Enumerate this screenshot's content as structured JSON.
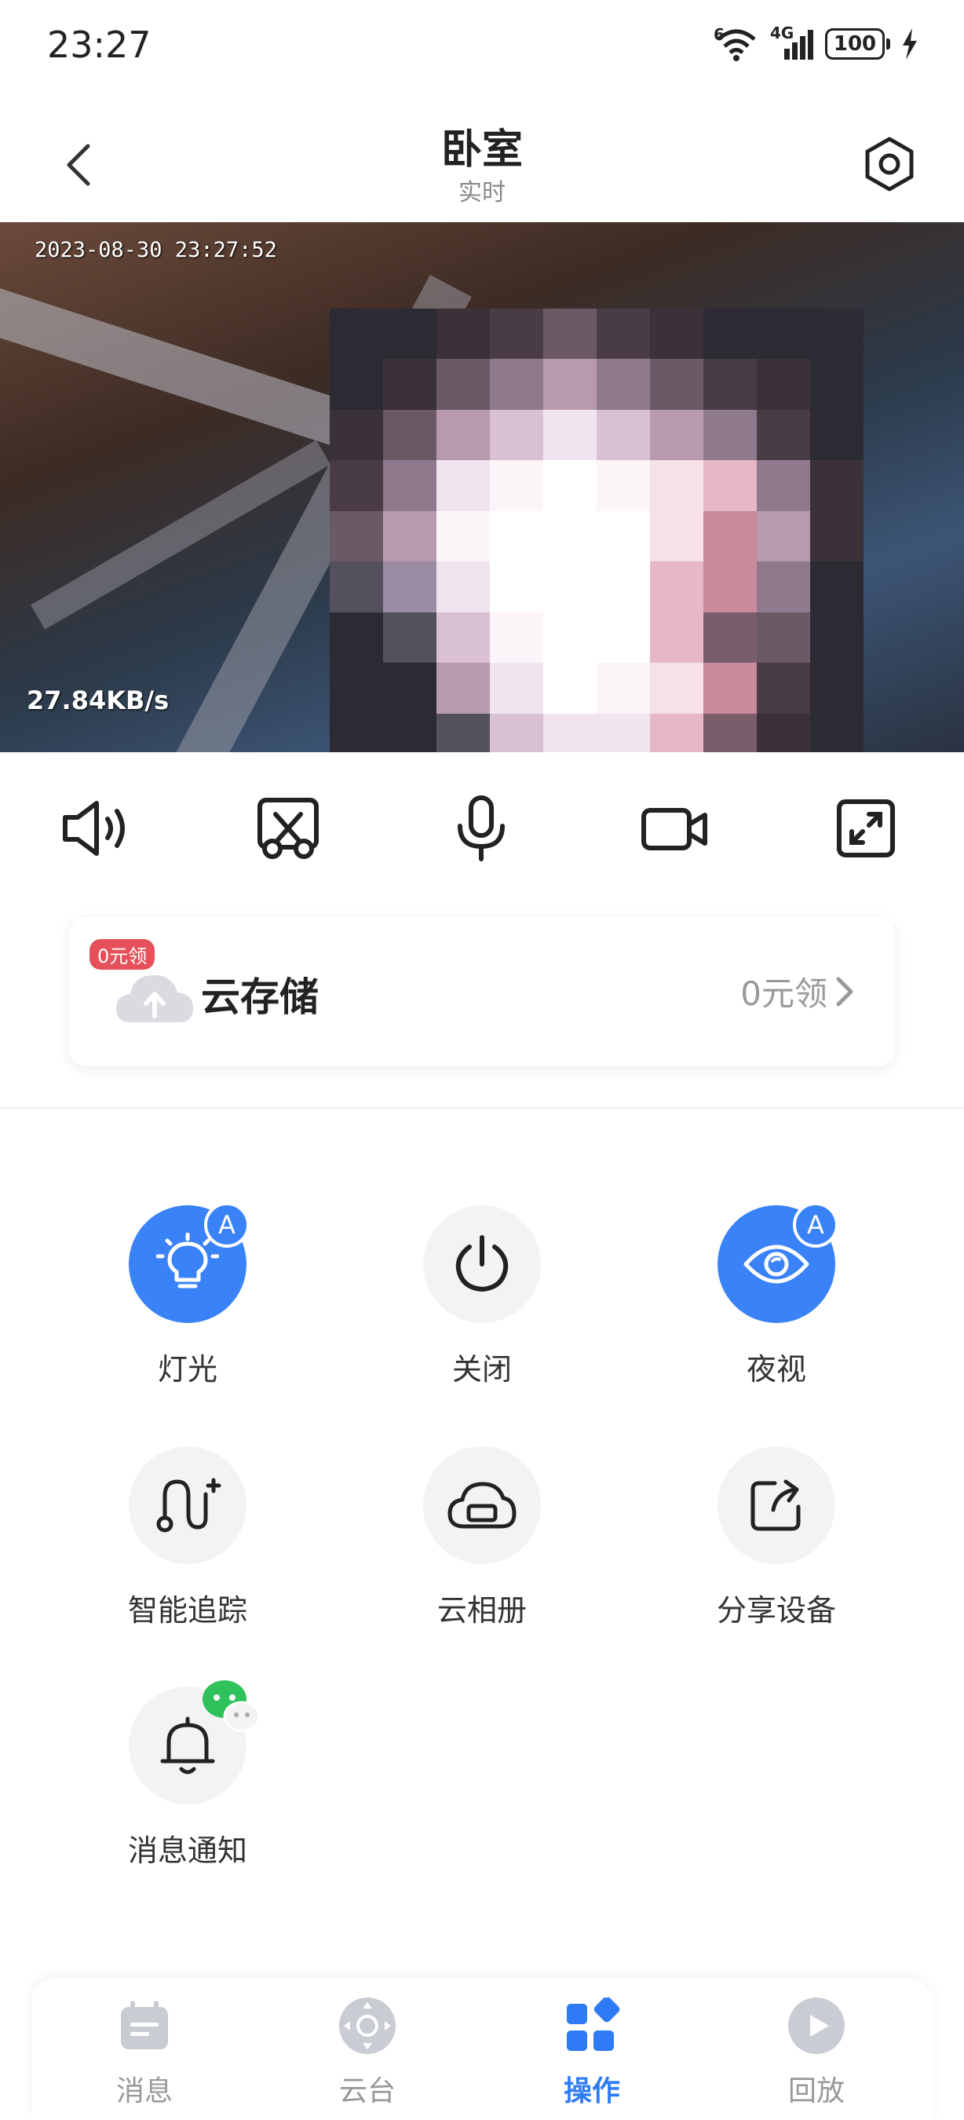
{
  "status_bar": {
    "time": "23:27",
    "wifi_label": "6",
    "network_label": "4G",
    "battery": "100"
  },
  "header": {
    "title": "卧室",
    "subtitle": "实时"
  },
  "video": {
    "timestamp": "2023-08-30 23:27:52",
    "bitrate": "27.84KB/s"
  },
  "controls": [
    {
      "icon": "speaker-icon"
    },
    {
      "icon": "screenshot-icon"
    },
    {
      "icon": "microphone-icon"
    },
    {
      "icon": "record-icon"
    },
    {
      "icon": "fullscreen-icon"
    }
  ],
  "cloud_storage": {
    "badge": "0元领",
    "title": "云存储",
    "action": "0元领"
  },
  "features": [
    {
      "label": "灯光",
      "icon": "light-icon",
      "active": true,
      "badge": "A"
    },
    {
      "label": "关闭",
      "icon": "power-icon",
      "active": false
    },
    {
      "label": "夜视",
      "icon": "eye-icon",
      "active": true,
      "badge": "A"
    },
    {
      "label": "智能追踪",
      "icon": "tracking-icon",
      "active": false
    },
    {
      "label": "云相册",
      "icon": "cloud-album-icon",
      "active": false
    },
    {
      "label": "分享设备",
      "icon": "share-icon",
      "active": false
    },
    {
      "label": "消息通知",
      "icon": "bell-icon",
      "active": false
    }
  ],
  "tabs": [
    {
      "label": "消息",
      "icon": "message-icon",
      "active": false
    },
    {
      "label": "云台",
      "icon": "ptz-icon",
      "active": false
    },
    {
      "label": "操作",
      "icon": "operate-icon",
      "active": true
    },
    {
      "label": "回放",
      "icon": "playback-icon",
      "active": false
    }
  ],
  "colors": {
    "accent": "#3a82f7",
    "tab_active": "#2f7bf5",
    "badge_red": "#e5505a",
    "wechat_green": "#2fc25b"
  }
}
